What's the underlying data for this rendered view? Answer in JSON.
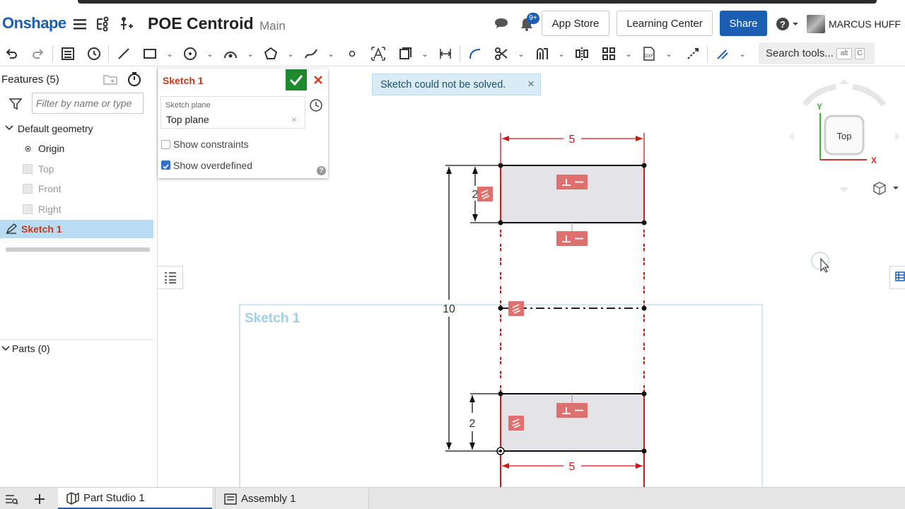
{
  "app": {
    "logo": "Onshape",
    "title": "POE Centroid",
    "branch": "Main"
  },
  "header": {
    "notifications_badge": "9+",
    "app_store_label": "App Store",
    "learning_center_label": "Learning Center",
    "share_label": "Share",
    "user_name": "MARCUS HUFF"
  },
  "toolbar": {
    "search_label": "Search tools...",
    "search_key1": "alt",
    "search_key2": "C"
  },
  "feature_tree": {
    "header": "Features (5)",
    "filter_placeholder": "Filter by name or type",
    "default_geometry": "Default geometry",
    "items": [
      "Origin",
      "Top",
      "Front",
      "Right"
    ],
    "sketch": "Sketch 1",
    "parts": "Parts (0)"
  },
  "sketch_dialog": {
    "title": "Sketch 1",
    "plane_label": "Sketch plane",
    "plane_value": "Top plane",
    "show_constraints": "Show constraints",
    "show_overdefined": "Show overdefined"
  },
  "toast": {
    "message": "Sketch could not be solved."
  },
  "canvas": {
    "sketch_label": "Sketch 1",
    "dims": {
      "top_width": "5",
      "bottom_width": "5",
      "overall_height": "10",
      "top_height": "2",
      "bottom_height": "2"
    }
  },
  "view_cube": {
    "face": "Top",
    "y_axis": "Y",
    "x_axis": "X"
  },
  "tabs": {
    "part_studio": "Part Studio 1",
    "assembly": "Assembly 1"
  },
  "colors": {
    "accent": "#1a5fb4",
    "overdefined": "#d01818",
    "sketch_blue": "#9fd0ea",
    "ok_green": "#1d8a2e"
  }
}
